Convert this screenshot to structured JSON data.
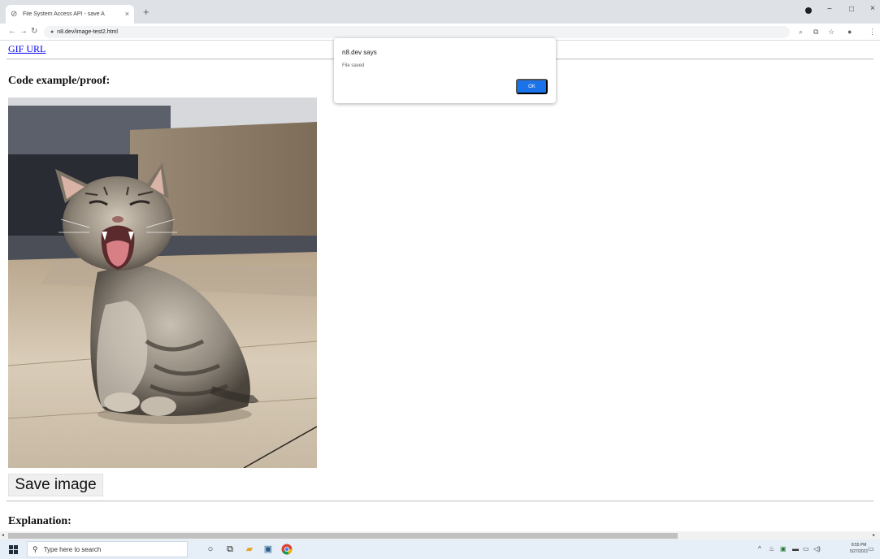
{
  "browser": {
    "tab_title": "File System Access API - save A",
    "tab_close": "×",
    "new_tab": "+",
    "url": "n8.dev/image-test2.html",
    "window_controls": {
      "minimize": "−",
      "restore": "□",
      "close": "×"
    }
  },
  "page": {
    "link_text": "GIF URL",
    "heading_code": "Code example/proof:",
    "save_button": "Save image",
    "heading_explanation": "Explanation:"
  },
  "dialog": {
    "title": "n8.dev says",
    "message": "File saved",
    "ok_label": "OK"
  },
  "taskbar": {
    "search_placeholder": "Type here to search",
    "clock_time": "8:55 PM",
    "clock_date": "5/27/2021"
  },
  "colors": {
    "link": "#0000ee",
    "dialog_button": "#1a73e8",
    "taskbar": "#e6eff8",
    "tab_strip": "#dee1e6"
  }
}
